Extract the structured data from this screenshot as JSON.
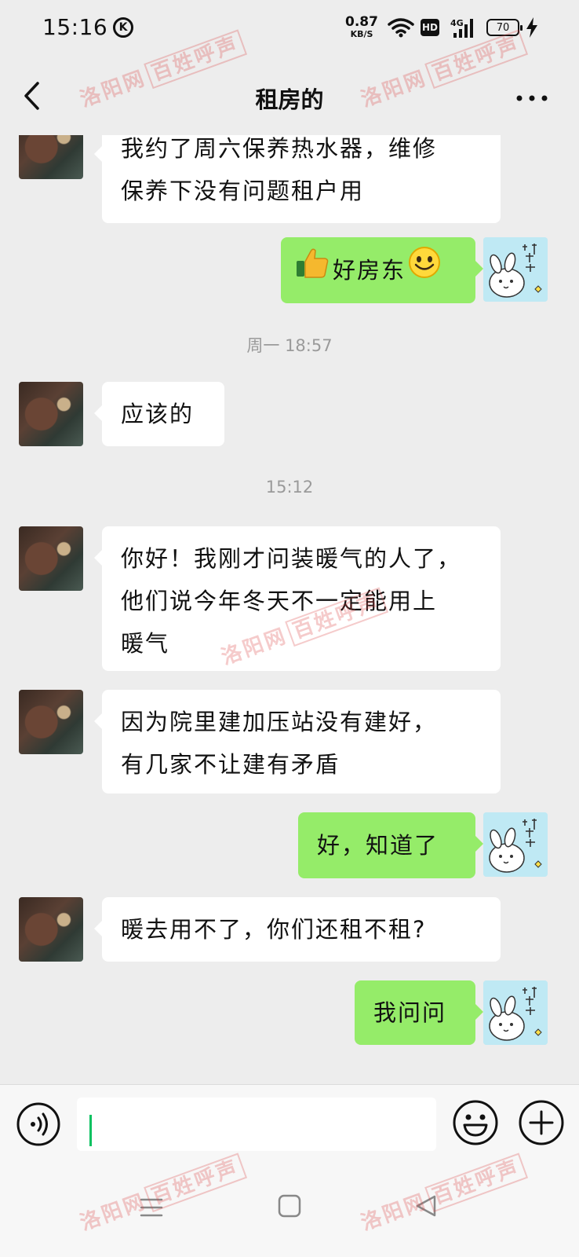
{
  "status_bar": {
    "time": "15:16",
    "k_badge": "K",
    "net_speed_value": "0.87",
    "net_speed_unit": "KB/S",
    "hd_label": "HD",
    "network_label": "4G",
    "battery_level": "70"
  },
  "header": {
    "title": "租房的"
  },
  "messages": [
    {
      "side": "in",
      "text_line1": "我约了周六保养热水器，维修",
      "text_line2": "保养下没有问题租户用"
    },
    {
      "side": "out",
      "text": "好房东"
    },
    {
      "timestamp": "周一 18:57"
    },
    {
      "side": "in",
      "text": "应该的"
    },
    {
      "timestamp": "15:12"
    },
    {
      "side": "in",
      "text_line1": "你好！我刚才问装暖气的人了，",
      "text_line2": "他们说今年冬天不一定能用上",
      "text_line3": "暖气"
    },
    {
      "side": "in",
      "text_line1": "因为院里建加压站没有建好，",
      "text_line2": "有几家不让建有矛盾"
    },
    {
      "side": "out",
      "text": "好，知道了"
    },
    {
      "side": "in",
      "text": "暖去用不了，你们还租不租?"
    },
    {
      "side": "out",
      "text": "我问问"
    }
  ],
  "input": {
    "value": ""
  },
  "icons": {
    "back": "chevron-left-icon",
    "more": "more-horizontal-icon",
    "voice": "voice-icon",
    "emoji": "emoji-icon",
    "add": "plus-circle-icon"
  },
  "watermark": {
    "brand": "洛阳网",
    "slogan": "百姓呼声"
  },
  "colors": {
    "background": "#ededed",
    "bubble_out": "#95ec69",
    "bubble_in": "#ffffff",
    "caret": "#07c160",
    "watermark": "#dc4646"
  }
}
